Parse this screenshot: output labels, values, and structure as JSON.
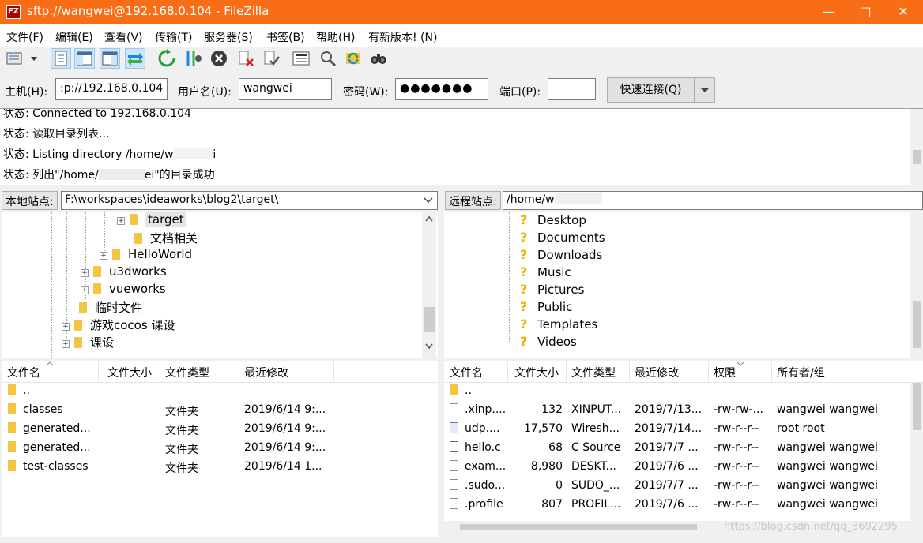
{
  "window": {
    "title": "sftp://wangwei@192.168.0.104 - FileZilla",
    "app_icon_text": "FZ"
  },
  "menu": [
    "文件(F)",
    "编辑(E)",
    "查看(V)",
    "传输(T)",
    "服务器(S)",
    "书签(B)",
    "帮助(H)",
    "有新版本! (N)"
  ],
  "quickconnect": {
    "host_label": "主机(H):",
    "host_value": ":p://192.168.0.104",
    "user_label": "用户名(U):",
    "user_value": "wangwei",
    "pass_label": "密码(W):",
    "pass_value": "●●●●●●●",
    "port_label": "端口(P):",
    "port_value": "",
    "connect_label": "快速连接(Q)"
  },
  "log": [
    "状态:  Connected to 192.168.0.104",
    "状态:  读取目录列表...",
    "状态:  Listing directory /home/w",
    "状态:  列出\"/home/",
    "ei\"的目录成功"
  ],
  "local": {
    "site_label": "本地站点:",
    "path": "F:\\workspaces\\ideaworks\\blog2\\target\\",
    "tree": [
      {
        "label": "target"
      },
      {
        "label": "文档相关"
      },
      {
        "label": "HelloWorld"
      },
      {
        "label": "u3dworks"
      },
      {
        "label": "vueworks"
      },
      {
        "label": "临时文件"
      },
      {
        "label": "游戏cocos 课设"
      },
      {
        "label": "课设"
      }
    ],
    "columns": [
      "文件名",
      "文件大小",
      "文件类型",
      "最近修改"
    ],
    "files": [
      {
        "name": "..",
        "size": "",
        "type": "",
        "modified": ""
      },
      {
        "name": "classes",
        "size": "",
        "type": "文件夹",
        "modified": "2019/6/14 9:..."
      },
      {
        "name": "generated...",
        "size": "",
        "type": "文件夹",
        "modified": "2019/6/14 9:..."
      },
      {
        "name": "generated...",
        "size": "",
        "type": "文件夹",
        "modified": "2019/6/14 9:..."
      },
      {
        "name": "test-classes",
        "size": "",
        "type": "文件夹",
        "modified": "2019/6/14 1..."
      }
    ]
  },
  "remote": {
    "site_label": "远程站点:",
    "path": "/home/w",
    "tree": [
      {
        "label": "Desktop"
      },
      {
        "label": "Documents"
      },
      {
        "label": "Downloads"
      },
      {
        "label": "Music"
      },
      {
        "label": "Pictures"
      },
      {
        "label": "Public"
      },
      {
        "label": "Templates"
      },
      {
        "label": "Videos"
      }
    ],
    "columns": [
      "文件名",
      "文件大小",
      "文件类型",
      "最近修改",
      "权限",
      "所有者/组"
    ],
    "files": [
      {
        "name": "..",
        "size": "",
        "type": "",
        "modified": "",
        "perms": "",
        "owner": ""
      },
      {
        "name": ".xinp....",
        "size": "132",
        "type": "XINPUT...",
        "modified": "2019/7/13...",
        "perms": "-rw-rw-...",
        "owner": "wangwei wangwei"
      },
      {
        "name": "udp....",
        "size": "17,570",
        "type": "Wiresh...",
        "modified": "2019/7/14...",
        "perms": "-rw-r--r--",
        "owner": "root root"
      },
      {
        "name": "hello.c",
        "size": "68",
        "type": "C Source",
        "modified": "2019/7/7 ...",
        "perms": "-rw-r--r--",
        "owner": "wangwei wangwei"
      },
      {
        "name": "exam...",
        "size": "8,980",
        "type": "DESKT...",
        "modified": "2019/7/6 ...",
        "perms": "-rw-r--r--",
        "owner": "wangwei wangwei"
      },
      {
        "name": ".sudo...",
        "size": "0",
        "type": "SUDO_...",
        "modified": "2019/7/7 ...",
        "perms": "-rw-r--r--",
        "owner": "wangwei wangwei"
      },
      {
        "name": ".profile",
        "size": "807",
        "type": "PROFIL...",
        "modified": "2019/7/6 ...",
        "perms": "-rw-r--r--",
        "owner": "wangwei wangwei"
      }
    ]
  },
  "watermark": "https://blog.csdn.net/qq_3692295"
}
